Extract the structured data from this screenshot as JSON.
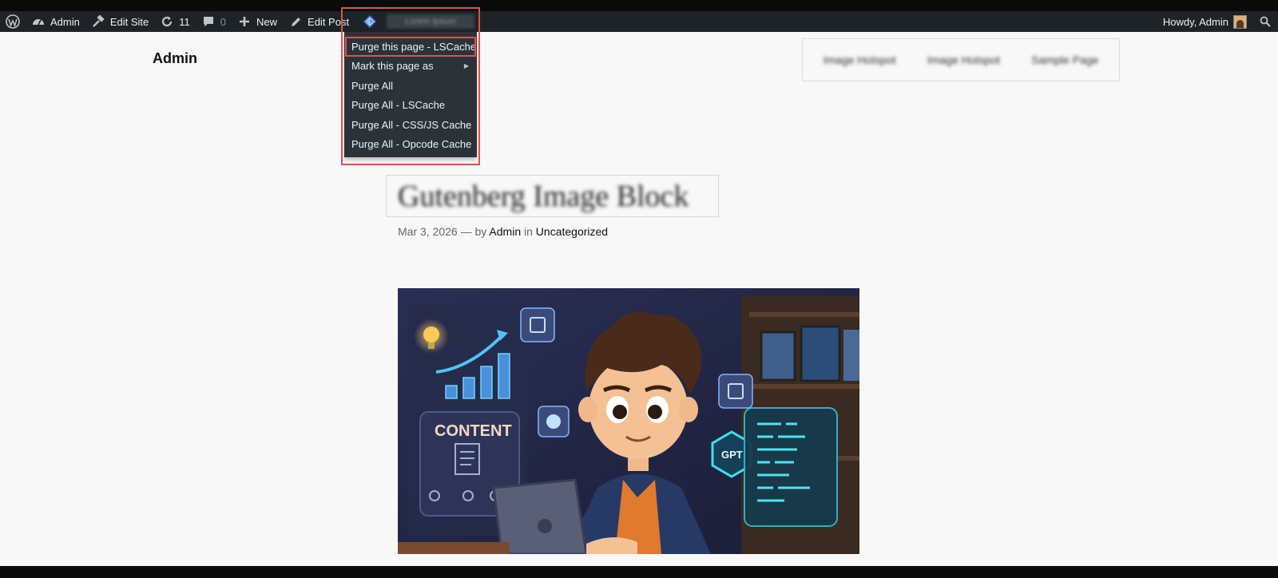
{
  "admin_bar": {
    "site_name": "Admin",
    "edit_site": "Edit Site",
    "updates_count": "11",
    "comments_count": "0",
    "new_label": "New",
    "edit_post": "Edit Post",
    "cache_status": "Lorem ipsum",
    "greeting": "Howdy, Admin"
  },
  "litespeed_menu": {
    "items": [
      {
        "label": "Purge this page - LSCache"
      },
      {
        "label": "Mark this page as"
      },
      {
        "label": "Purge All"
      },
      {
        "label": "Purge All - LSCache"
      },
      {
        "label": "Purge All - CSS/JS Cache"
      },
      {
        "label": "Purge All - Opcode Cache"
      }
    ]
  },
  "site": {
    "title": "Admin",
    "nav": [
      "Image Hotspot",
      "Image Hotspot",
      "Sample Page"
    ]
  },
  "post": {
    "title": "Gutenberg Image Block",
    "date": "Mar 3, 2026",
    "separator": "—",
    "by": "by",
    "author": "Admin",
    "in": "in",
    "category": "Uncategorized"
  },
  "featured_image": {
    "content_label": "CONTENT",
    "gpt_label": "GPT"
  },
  "colors": {
    "admin_bar": "#1d2327",
    "menu_bg": "#2c3338",
    "highlight": "#d9534f",
    "page_bg": "#f8f8f8"
  }
}
